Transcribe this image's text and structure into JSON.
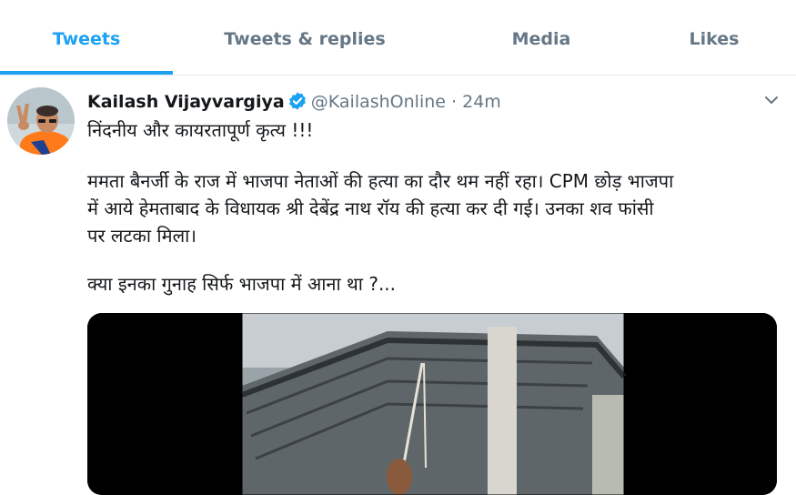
{
  "tabs": [
    {
      "label": "Tweets",
      "active": true
    },
    {
      "label": "Tweets & replies",
      "active": false
    },
    {
      "label": "Media",
      "active": false
    },
    {
      "label": "Likes",
      "active": false
    }
  ],
  "tweet": {
    "author_name": "Kailash Vijayvargiya",
    "verified": true,
    "handle": "@KailashOnline",
    "separator": "·",
    "time": "24m",
    "lines": [
      "निंदनीय और कायरतापूर्ण कृत्य !!!",
      "ममता बैनर्जी के राज में भाजपा नेताओं की हत्या का दौर थम नहीं रहा। CPM छोड़ भाजपा",
      "में आये हेमताबाद के विधायक श्री देबेंद्र नाथ रॉय की हत्या कर दी गई। उनका शव फांसी",
      "पर लटका मिला।",
      "क्या इनका गुनाह सिर्फ भाजपा में आना था ?..."
    ],
    "media": {
      "kind": "video-thumbnail"
    }
  },
  "colors": {
    "accent": "#1da1f2",
    "secondary_text": "#657786",
    "border": "#e6ecf0"
  },
  "icons": [
    "verified-badge-icon",
    "chevron-down-icon"
  ]
}
